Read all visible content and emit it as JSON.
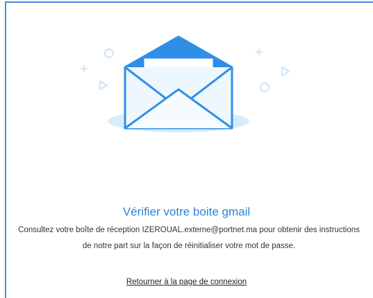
{
  "illustration": {
    "icon": "open-envelope-icon",
    "accent_color": "#2f8fe8",
    "light_color": "#e3f1fc"
  },
  "content": {
    "title": "Vérifier votre boite gmail",
    "description": "Consultez votre boîte de réception IZEROUAL.externe@portnet.ma pour obtenir des instructions de notre part sur la façon de réinitialiser votre mot de passe.",
    "back_link": "Retourner à la page de connexion"
  },
  "colors": {
    "title": "#2f7fd6",
    "border": "#3b8fe6"
  }
}
